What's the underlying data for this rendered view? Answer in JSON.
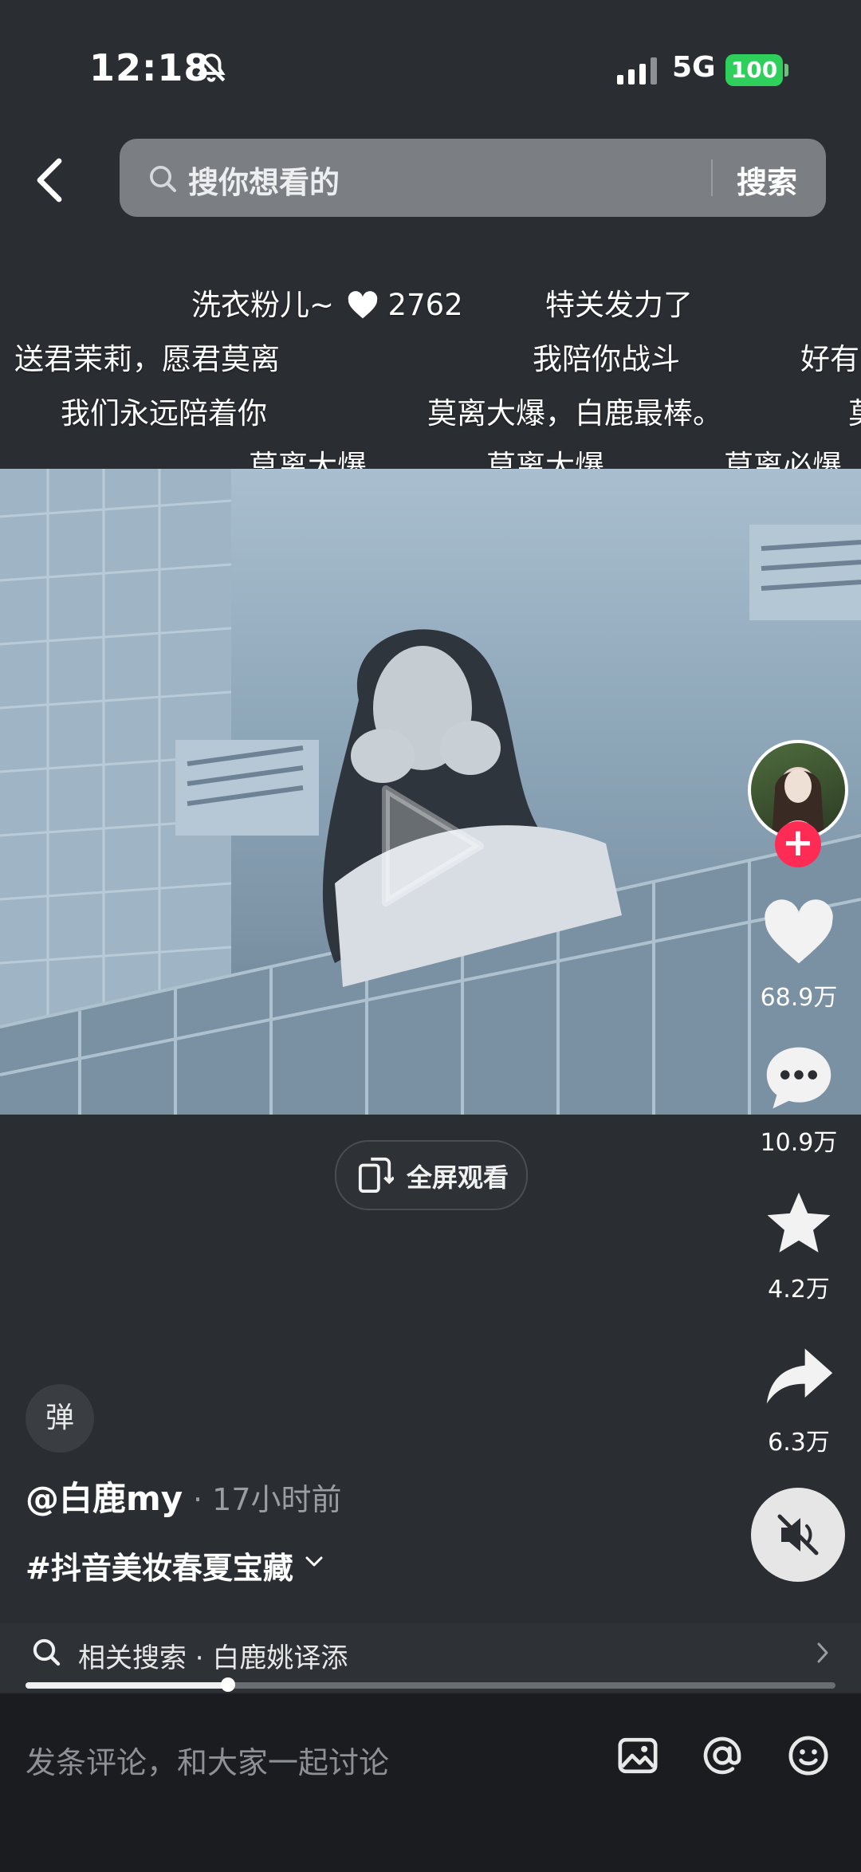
{
  "status": {
    "time": "12:18",
    "network": "5G",
    "battery": "100"
  },
  "search": {
    "placeholder": "搜你想看的",
    "button": "搜索"
  },
  "danmaku": {
    "highlight": {
      "text": "洗衣粉儿~",
      "likes": "2762"
    },
    "rows": [
      [
        "特关发力了"
      ],
      [
        "送君茉莉，愿君莫离",
        "我陪你战斗",
        "好有"
      ],
      [
        "我们永远陪着你",
        "莫离大爆，白鹿最棒。",
        "莫"
      ],
      [
        "莫离大爆",
        "莫离大爆",
        "莫离必爆"
      ]
    ]
  },
  "fullscreen_label": "全屏观看",
  "actions": {
    "likes": "68.9万",
    "comments": "10.9万",
    "favorites": "4.2万",
    "shares": "6.3万"
  },
  "follow_symbol": "+",
  "danmu_toggle": "弹",
  "post": {
    "author": "@白鹿my",
    "time_ago": "· 17小时前",
    "hashtag": "#抖音美妆春夏宝藏"
  },
  "related_search": "相关搜索 · 白鹿姚译添",
  "progress_fraction": 0.25,
  "comment_placeholder": "发条评论，和大家一起讨论",
  "colors": {
    "accent": "#fe2c55",
    "battery": "#2fcf5b",
    "background": "#2a2d32"
  },
  "icons": [
    "bell-slash-icon",
    "signal-icon",
    "back-icon",
    "search-icon",
    "heart-icon",
    "comment-icon",
    "star-icon",
    "share-icon",
    "mute-icon",
    "image-icon",
    "at-icon",
    "emoji-icon"
  ]
}
